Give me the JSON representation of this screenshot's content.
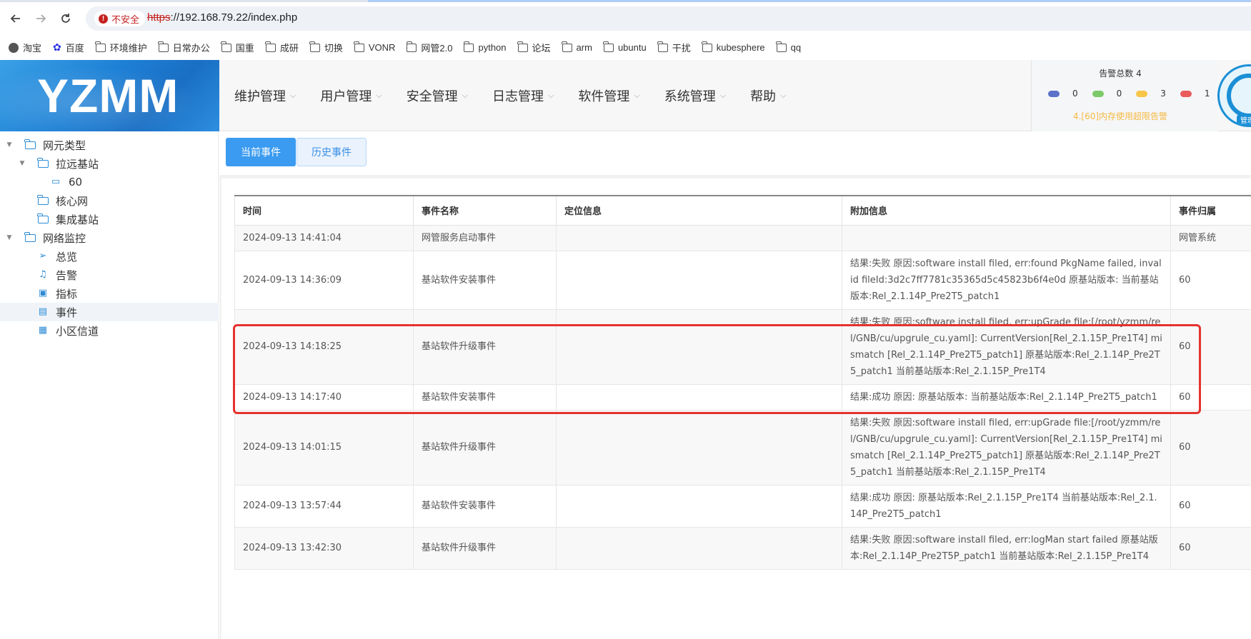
{
  "browser": {
    "security_label": "不安全",
    "url_scheme": "https",
    "url_rest": "://192.168.79.22/index.php",
    "bookmarks": [
      {
        "label": "淘宝",
        "icon": "globe-icon"
      },
      {
        "label": "百度",
        "icon": "baidu-paw-icon"
      },
      {
        "label": "环境维护",
        "icon": "folder-icon"
      },
      {
        "label": "日常办公",
        "icon": "folder-icon"
      },
      {
        "label": "国重",
        "icon": "folder-icon"
      },
      {
        "label": "成研",
        "icon": "folder-icon"
      },
      {
        "label": "切换",
        "icon": "folder-icon"
      },
      {
        "label": "VONR",
        "icon": "folder-icon"
      },
      {
        "label": "网管2.0",
        "icon": "folder-icon"
      },
      {
        "label": "python",
        "icon": "folder-icon"
      },
      {
        "label": "论坛",
        "icon": "folder-icon"
      },
      {
        "label": "arm",
        "icon": "folder-icon"
      },
      {
        "label": "ubuntu",
        "icon": "folder-icon"
      },
      {
        "label": "干扰",
        "icon": "folder-icon"
      },
      {
        "label": "kubesphere",
        "icon": "folder-icon"
      },
      {
        "label": "qq",
        "icon": "folder-icon"
      }
    ]
  },
  "header": {
    "logo": "YZMM",
    "menu": [
      "维护管理",
      "用户管理",
      "安全管理",
      "日志管理",
      "软件管理",
      "系统管理",
      "帮助"
    ],
    "alarm": {
      "title": "告警总数 4",
      "levels": [
        {
          "color": "#5b72c9",
          "count": "0"
        },
        {
          "color": "#7cc96a",
          "count": "0"
        },
        {
          "color": "#f7c548",
          "count": "3"
        },
        {
          "color": "#ea5b5b",
          "count": "1"
        }
      ],
      "message": "4.[60]内存使用超限告警"
    },
    "avatar_tag": "管理"
  },
  "sidebar": {
    "nodes": [
      {
        "label": "网元类型",
        "icon": "folder-open-icon",
        "level": 0,
        "expand": "▼"
      },
      {
        "label": "拉远基站",
        "icon": "folder-open-icon",
        "level": 1,
        "expand": "▼"
      },
      {
        "label": "60",
        "icon": "monitor-icon",
        "level": 2,
        "expand": ""
      },
      {
        "label": "核心网",
        "icon": "folder-icon",
        "level": 1,
        "expand": ""
      },
      {
        "label": "集成基站",
        "icon": "folder-icon",
        "level": 1,
        "expand": ""
      },
      {
        "label": "网络监控",
        "icon": "folder-open-icon",
        "level": 0,
        "expand": "▼"
      },
      {
        "label": "总览",
        "icon": "navigation-icon",
        "level": 1,
        "expand": ""
      },
      {
        "label": "告警",
        "icon": "bell-icon",
        "level": 1,
        "expand": ""
      },
      {
        "label": "指标",
        "icon": "chart-board-icon",
        "level": 1,
        "expand": ""
      },
      {
        "label": "事件",
        "icon": "document-icon",
        "level": 1,
        "expand": "",
        "active": true
      },
      {
        "label": "小区信道",
        "icon": "grid-icon",
        "level": 1,
        "expand": ""
      }
    ]
  },
  "tabs": {
    "current": "当前事件",
    "history": "历史事件"
  },
  "table": {
    "headers": [
      "时间",
      "事件名称",
      "定位信息",
      "附加信息",
      "事件归属"
    ],
    "rows": [
      {
        "time": "2024-09-13 14:41:04",
        "name": "网管服务启动事件",
        "location": "",
        "info": "",
        "owner": "网管系统"
      },
      {
        "time": "2024-09-13 14:36:09",
        "name": "基站软件安装事件",
        "location": "",
        "info": "结果:失败 原因:software install filed, err:found PkgName failed, invalid fileId:3d2c7ff7781c35365d5c45823b6f4e0d 原基站版本: 当前基站版本:Rel_2.1.14P_Pre2T5_patch1",
        "owner": "60"
      },
      {
        "time": "2024-09-13 14:18:25",
        "name": "基站软件升级事件",
        "location": "",
        "info": "结果:失败 原因:software install filed, err:upGrade file:[/root/yzmm/rel/GNB/cu/upgrule_cu.yaml]: CurrentVersion[Rel_2.1.15P_Pre1T4] mismatch [Rel_2.1.14P_Pre2T5_patch1] 原基站版本:Rel_2.1.14P_Pre2T5_patch1 当前基站版本:Rel_2.1.15P_Pre1T4",
        "owner": "60"
      },
      {
        "time": "2024-09-13 14:17:40",
        "name": "基站软件安装事件",
        "location": "",
        "info": "结果:成功 原因: 原基站版本: 当前基站版本:Rel_2.1.14P_Pre2T5_patch1",
        "owner": "60"
      },
      {
        "time": "2024-09-13 14:01:15",
        "name": "基站软件升级事件",
        "location": "",
        "info": "结果:失败 原因:software install filed, err:upGrade file:[/root/yzmm/rel/GNB/cu/upgrule_cu.yaml]: CurrentVersion[Rel_2.1.15P_Pre1T4] mismatch [Rel_2.1.14P_Pre2T5_patch1] 原基站版本:Rel_2.1.14P_Pre2T5_patch1 当前基站版本:Rel_2.1.15P_Pre1T4",
        "owner": "60"
      },
      {
        "time": "2024-09-13 13:57:44",
        "name": "基站软件安装事件",
        "location": "",
        "info": "结果:成功 原因: 原基站版本:Rel_2.1.15P_Pre1T4 当前基站版本:Rel_2.1.14P_Pre2T5_patch1",
        "owner": "60"
      },
      {
        "time": "2024-09-13 13:42:30",
        "name": "基站软件升级事件",
        "location": "",
        "info": "结果:失败 原因:software install filed, err:logMan start failed 原基站版本:Rel_2.1.14P_Pre2T5P_patch1 当前基站版本:Rel_2.1.15P_Pre1T4",
        "owner": "60"
      }
    ]
  }
}
